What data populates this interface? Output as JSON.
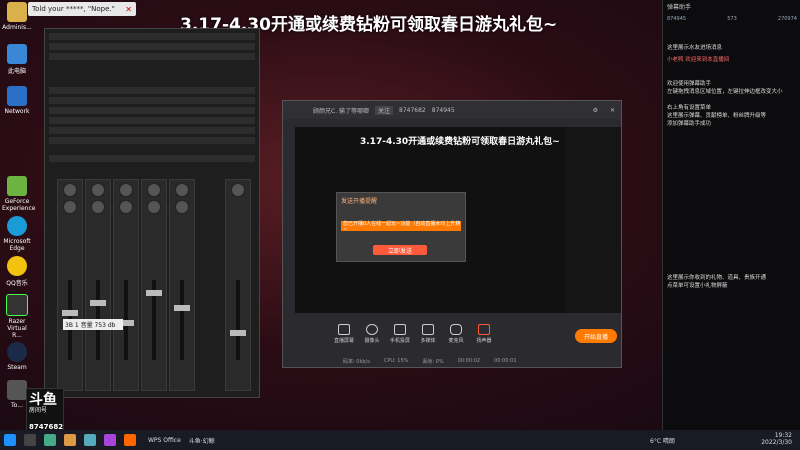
{
  "banner": {
    "main": "3.17-4.30开通或续费钻粉可领取春日游丸礼包~",
    "small": "3.17-4.30开通或续费钻粉可领取春日游丸礼包~"
  },
  "notification": {
    "text": "Told your *****, \"Nope.\""
  },
  "desktop_icons": [
    "Adminis...",
    "此电脑",
    "Network",
    "GeForce Experience",
    "Microsoft Edge",
    "QQ音乐",
    "Razer Virtual R...",
    "Steam",
    "To..."
  ],
  "mixer": {
    "caption": "3B 1 音量 753 db"
  },
  "live_window": {
    "title": "顾颜兄C. 输了等哪卿",
    "follow": "关注",
    "id": "8747682",
    "fans": "874945",
    "toolbar": [
      "直播屏幕",
      "摄像头",
      "手机投屏",
      "多媒体",
      "麦克风",
      "扬声器"
    ],
    "start_label": "开始直播",
    "status": [
      "码率: 0kb/s",
      "CPU: 15%",
      "丢帧: 0%",
      "00:00:02",
      "00:00:01"
    ]
  },
  "dialog": {
    "title": "发送开播提醒",
    "text": "您已开播0人在线一起玩~功能（自动直播水印上升精~",
    "button": "立即发送"
  },
  "panel": {
    "header": "弹幕助手",
    "stats": [
      "874945",
      "573",
      "270974"
    ],
    "messages": [
      "这里展示水友进场消息",
      "小老鸭 欢迎来到本直播间",
      "欢迎使用弹幕助手",
      "左键拖拽消息区域位置，左键拉伸边框改变大小",
      "右上角有设置菜单",
      "这里展示弹幕、贡献榜单、粉丝牌升级等",
      "添加弹幕助手成功"
    ],
    "gift_note": "这里展示你收到的礼物、道具、贵族开通",
    "gift_note2": "点菜单可设置小礼物屏蔽"
  },
  "card": {
    "logo": "斗鱼",
    "label": "房间号",
    "number": "8747682"
  },
  "taskbar": {
    "weather": "6°C 晴朗",
    "time": "19:32",
    "date": "2022/3/30",
    "apps": [
      "WPS Office",
      "斗鱼·幻鲸"
    ]
  }
}
